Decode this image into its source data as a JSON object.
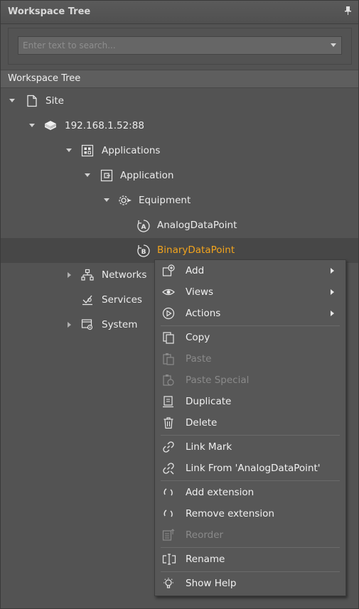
{
  "panel": {
    "title": "Workspace Tree",
    "pin_glyph": "‖"
  },
  "search": {
    "placeholder": "Enter text to search..."
  },
  "section_header": "Workspace Tree",
  "tree": {
    "site": "Site",
    "host": "192.168.1.52:88",
    "applications": "Applications",
    "application": "Application",
    "equipment": "Equipment",
    "analog": "AnalogDataPoint",
    "binary": "BinaryDataPoint",
    "networks": "Networks",
    "services": "Services",
    "system": "System"
  },
  "menu": {
    "add": "Add",
    "views": "Views",
    "actions": "Actions",
    "copy": "Copy",
    "paste": "Paste",
    "paste_special": "Paste Special",
    "duplicate": "Duplicate",
    "delete": "Delete",
    "link_mark": "Link Mark",
    "link_from": "Link From 'AnalogDataPoint'",
    "add_extension": "Add extension",
    "remove_extension": "Remove extension",
    "reorder": "Reorder",
    "rename": "Rename",
    "show_help": "Show Help"
  },
  "colors": {
    "highlight": "#f2a41d",
    "background": "#535353"
  }
}
